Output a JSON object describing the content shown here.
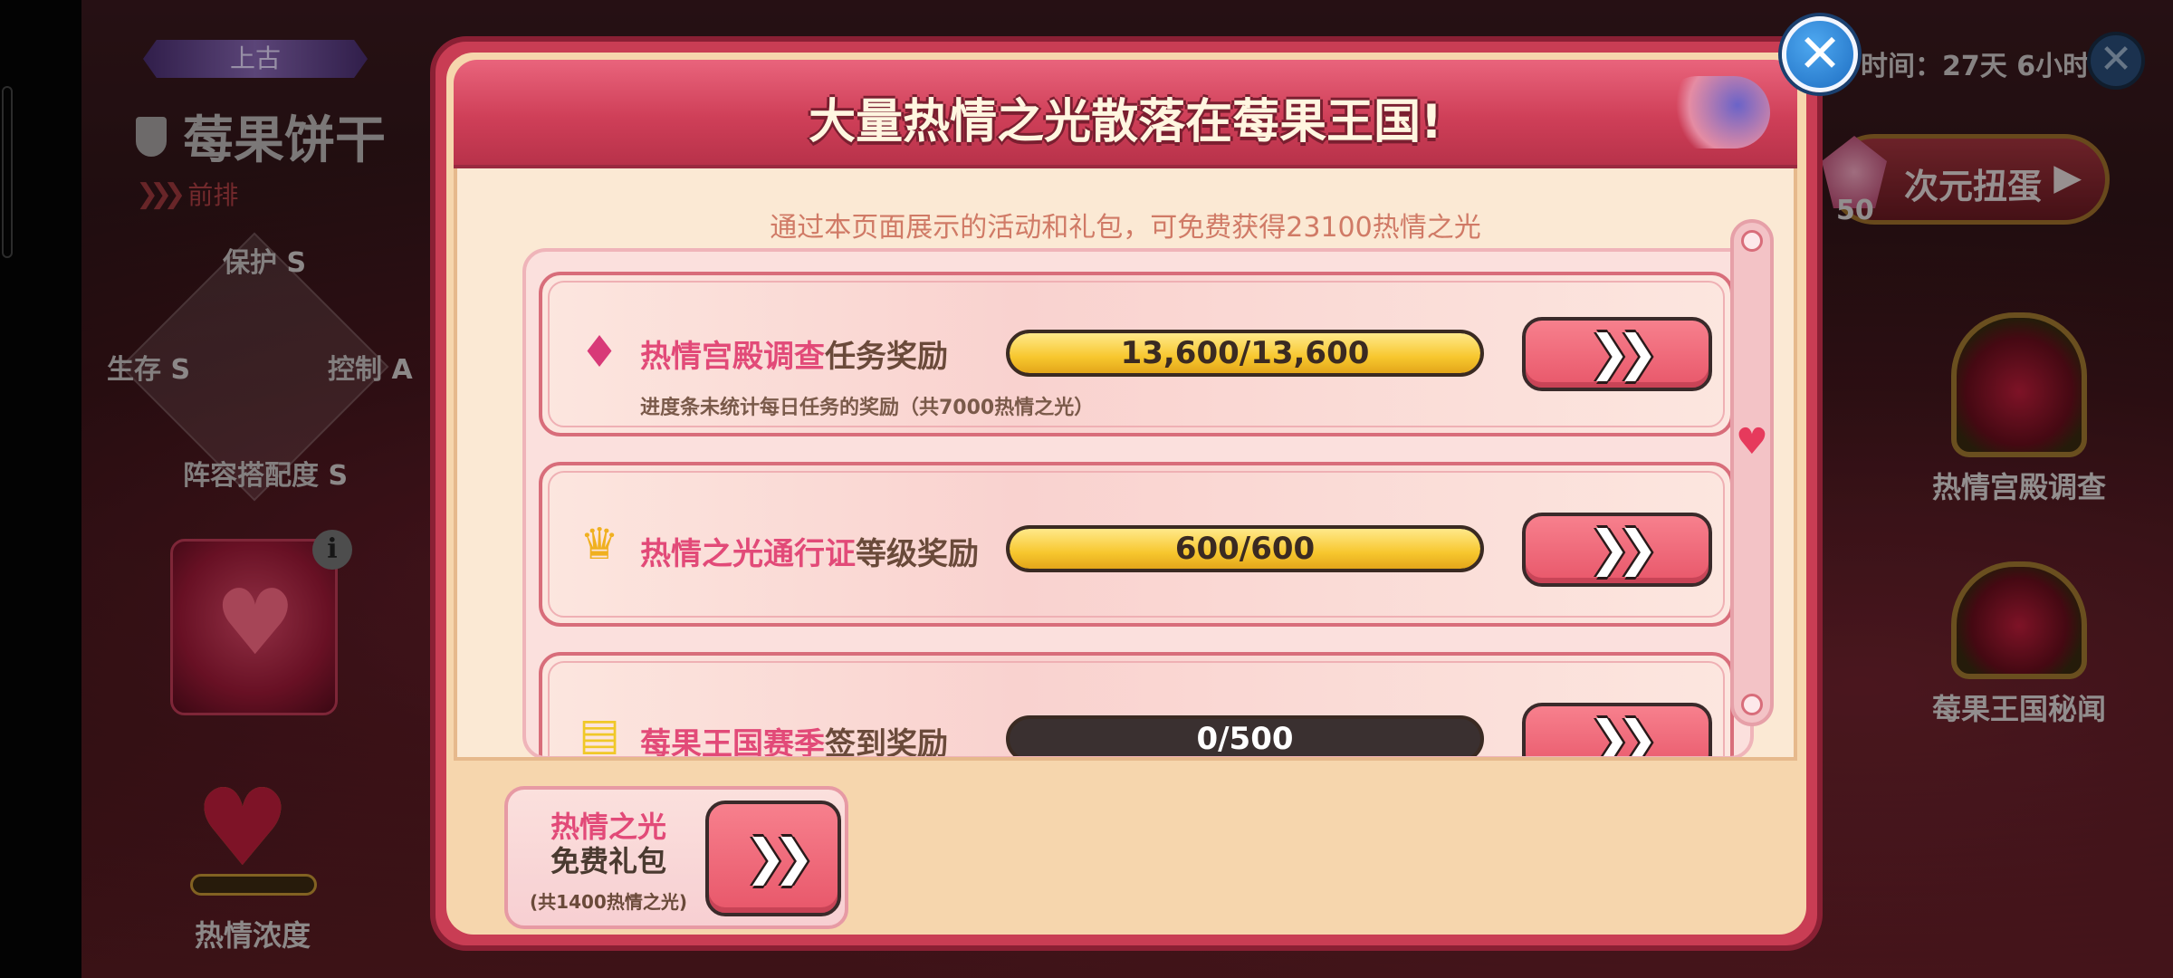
{
  "background": {
    "rank_tag": "上古",
    "hero_name": "莓果饼干",
    "position_label": "前排",
    "stats": {
      "protect": "保护",
      "protect_grade": "S",
      "survive": "生存",
      "survive_grade": "S",
      "control": "控制",
      "control_grade": "A",
      "synergy": "阵容搭配度",
      "synergy_grade": "S"
    },
    "passion_label": "热情浓度",
    "timer": "时间：27天 6小时",
    "gacha_label": "次元扭蛋",
    "gacha_count": "50",
    "side_features": [
      "热情宫殿调查",
      "莓果王国秘闻"
    ]
  },
  "popup": {
    "title": "大量热情之光散落在莓果王国!",
    "subtitle": "通过本页面展示的活动和礼包，可免费获得23100热情之光",
    "tasks": [
      {
        "highlight": "热情宫殿调查",
        "label": "任务奖励",
        "note": "进度条未统计每日任务的奖励（共7000热情之光）",
        "progress_text": "13,600/13,600",
        "progress": 1.0,
        "icon": "lantern-icon"
      },
      {
        "highlight": "热情之光通行证",
        "label": "等级奖励",
        "note": "",
        "progress_text": "600/600",
        "progress": 1.0,
        "icon": "crown-icon"
      },
      {
        "highlight": "莓果王国赛季",
        "label": "签到奖励",
        "note": "",
        "progress_text": "0/500",
        "progress": 0.0,
        "icon": "calendar-icon"
      }
    ],
    "gift": {
      "line1": "热情之光",
      "line2": "免费礼包",
      "line3": "(共1400热情之光)"
    }
  },
  "colors": {
    "accent_pink": "#e24a78",
    "button": "#e8576a",
    "progress_fill": "#f7c72e",
    "close_blue": "#1e6ec2"
  }
}
